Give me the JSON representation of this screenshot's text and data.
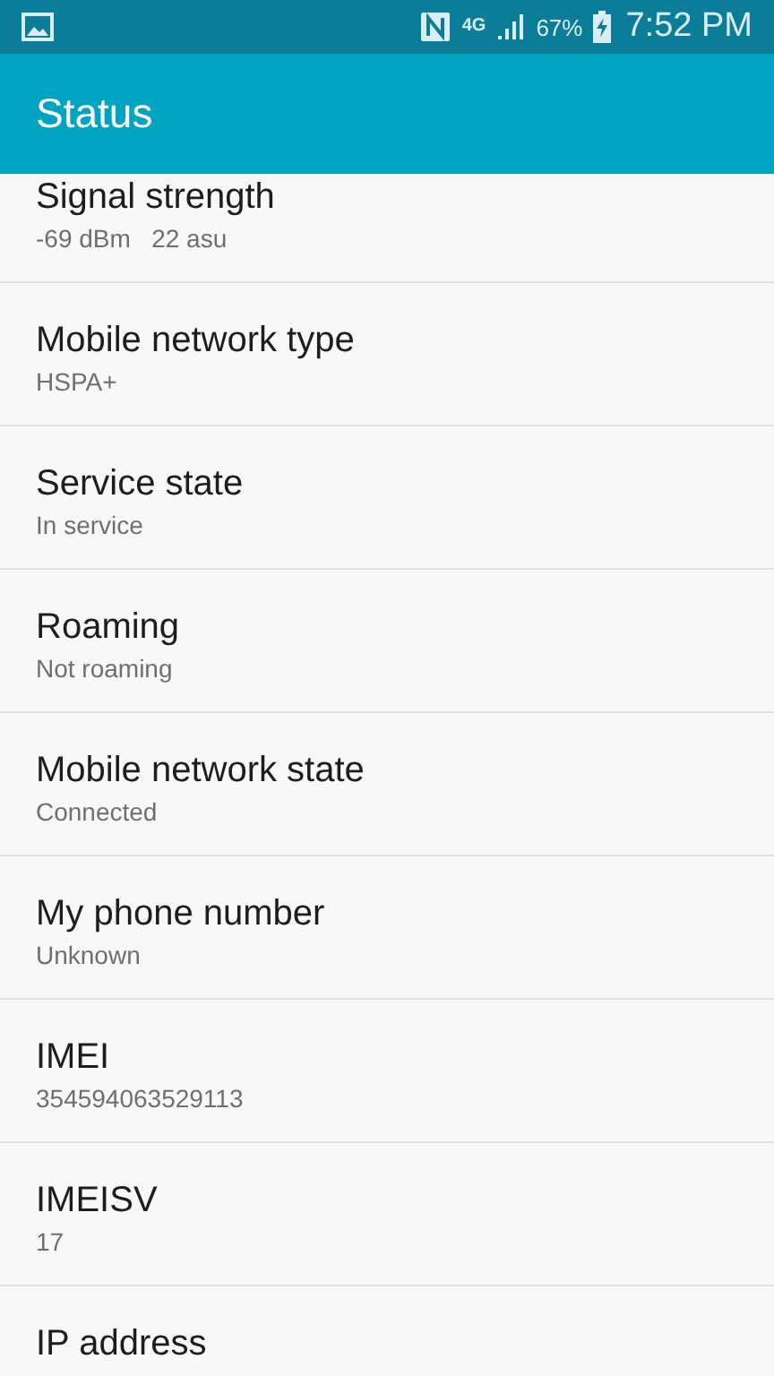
{
  "status_bar": {
    "network": "4G",
    "battery": "67%",
    "time": "7:52 PM"
  },
  "app_bar": {
    "title": "Status"
  },
  "items": [
    {
      "title": "Signal strength",
      "value": "-69 dBm   22 asu"
    },
    {
      "title": "Mobile network type",
      "value": "HSPA+"
    },
    {
      "title": "Service state",
      "value": "In service"
    },
    {
      "title": "Roaming",
      "value": "Not roaming"
    },
    {
      "title": "Mobile network state",
      "value": "Connected"
    },
    {
      "title": "My phone number",
      "value": "Unknown"
    },
    {
      "title": "IMEI",
      "value": "354594063529113"
    },
    {
      "title": "IMEISV",
      "value": "17"
    },
    {
      "title": "IP address"
    }
  ]
}
